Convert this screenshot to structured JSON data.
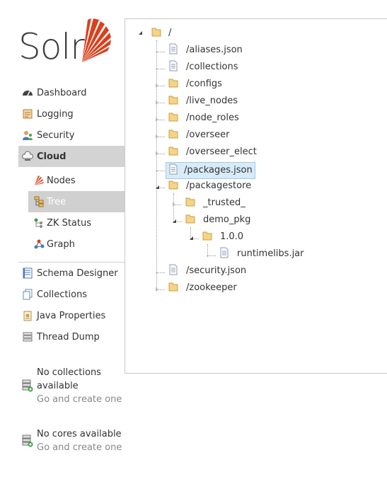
{
  "logo": {
    "text": "Solr",
    "accent": "#d9411e"
  },
  "nav": {
    "items": [
      {
        "label": "Dashboard",
        "icon": "dashboard-icon"
      },
      {
        "label": "Logging",
        "icon": "logging-icon"
      },
      {
        "label": "Security",
        "icon": "security-icon"
      },
      {
        "label": "Cloud",
        "icon": "cloud-icon",
        "active": true
      },
      {
        "label": "Schema Designer",
        "icon": "schema-designer-icon"
      },
      {
        "label": "Collections",
        "icon": "collections-icon"
      },
      {
        "label": "Java Properties",
        "icon": "java-properties-icon"
      },
      {
        "label": "Thread Dump",
        "icon": "thread-dump-icon"
      }
    ],
    "cloud_sub": [
      {
        "label": "Nodes",
        "icon": "nodes-icon"
      },
      {
        "label": "Tree",
        "icon": "tree-icon",
        "active": true
      },
      {
        "label": "ZK Status",
        "icon": "zk-status-icon"
      },
      {
        "label": "Graph",
        "icon": "graph-icon"
      }
    ]
  },
  "status": {
    "collections_title": "No collections available",
    "collections_link": "Go and create one",
    "cores_title": "No cores available",
    "cores_link": "Go and create one"
  },
  "tree": {
    "root": "/",
    "nodes": [
      {
        "label": "/aliases.json",
        "type": "file"
      },
      {
        "label": "/collections",
        "type": "file"
      },
      {
        "label": "/configs",
        "type": "folder"
      },
      {
        "label": "/live_nodes",
        "type": "folder"
      },
      {
        "label": "/node_roles",
        "type": "folder"
      },
      {
        "label": "/overseer",
        "type": "folder"
      },
      {
        "label": "/overseer_elect",
        "type": "folder"
      },
      {
        "label": "/packages.json",
        "type": "file",
        "selected": true
      },
      {
        "label": "/packagestore",
        "type": "folder",
        "expanded": true
      },
      {
        "label": "_trusted_",
        "type": "folder"
      },
      {
        "label": "demo_pkg",
        "type": "folder",
        "expanded": true
      },
      {
        "label": "1.0.0",
        "type": "folder",
        "expanded": true
      },
      {
        "label": "runtimelibs.jar",
        "type": "file"
      },
      {
        "label": "/security.json",
        "type": "file"
      },
      {
        "label": "/zookeeper",
        "type": "folder"
      }
    ]
  }
}
